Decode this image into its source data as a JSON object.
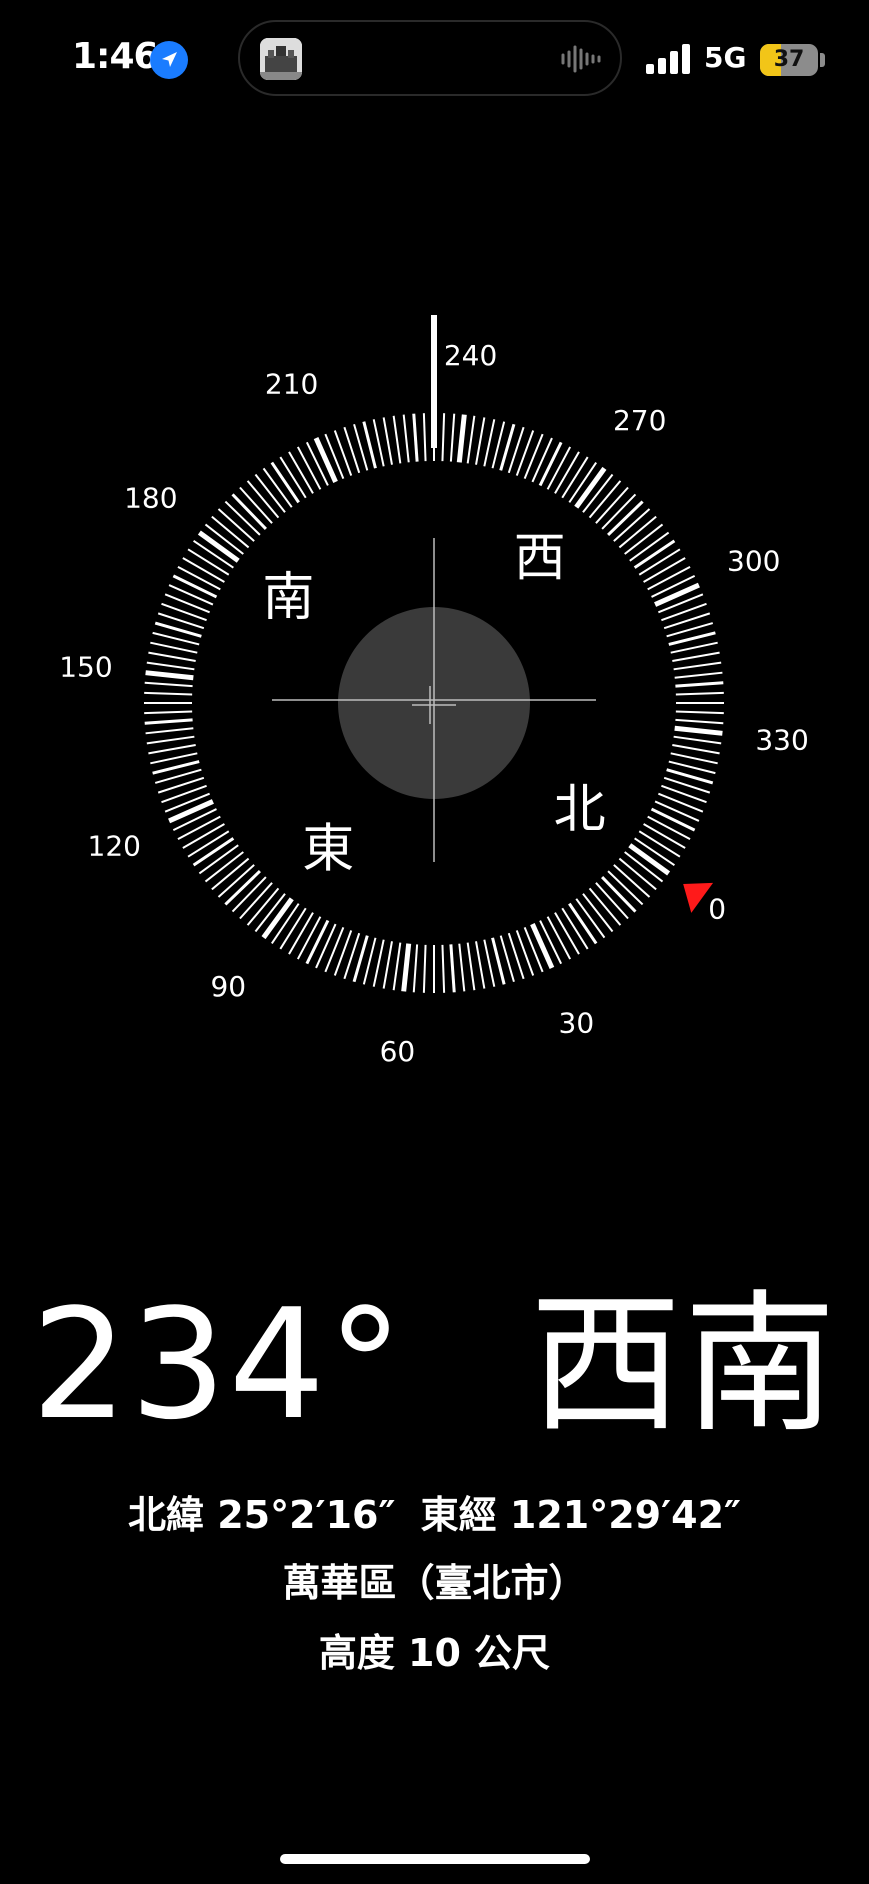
{
  "status_bar": {
    "time": "1:46",
    "location_icon": "location-arrow-icon",
    "network": "5G",
    "battery_percent": "37",
    "battery_level": 0.37,
    "battery_color": "#f2c518",
    "dynamic_island": {
      "thumbnail_icon": "building-thumbnail-icon",
      "activity_icon": "audio-waveform-icon"
    }
  },
  "compass": {
    "heading_degrees": 234,
    "degree_labels": [
      "0",
      "30",
      "60",
      "90",
      "120",
      "150",
      "180",
      "210",
      "240",
      "270",
      "300",
      "330"
    ],
    "cardinals": {
      "north": "北",
      "east": "東",
      "south": "南",
      "west": "西"
    },
    "north_marker_color": "#ff1a1a",
    "level_circle_color": "#3a3a3a"
  },
  "readout": {
    "degree_text": "234°",
    "direction_text": "西南",
    "latitude": "北緯 25°2′16″",
    "longitude": "東經 121°29′42″",
    "place": "萬華區（臺北市）",
    "elevation": "高度 10 公尺"
  }
}
